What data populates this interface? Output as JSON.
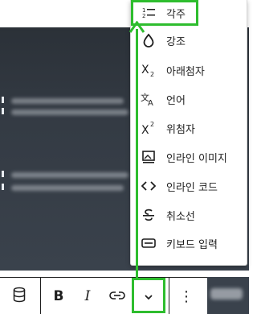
{
  "menu": {
    "items": [
      {
        "label": "각주",
        "icon": "footnote-icon"
      },
      {
        "label": "강조",
        "icon": "drop-icon"
      },
      {
        "label": "아래첨자",
        "icon": "subscript-icon"
      },
      {
        "label": "언어",
        "icon": "language-icon"
      },
      {
        "label": "위첨자",
        "icon": "superscript-icon"
      },
      {
        "label": "인라인 이미지",
        "icon": "inline-image-icon"
      },
      {
        "label": "인라인 코드",
        "icon": "code-icon"
      },
      {
        "label": "취소선",
        "icon": "strikethrough-icon"
      },
      {
        "label": "키보드 입력",
        "icon": "keyboard-icon"
      }
    ]
  },
  "toolbar": {
    "bold_label": "B",
    "italic_label": "I",
    "more_label": "⋮",
    "chevron_label": "⌄"
  },
  "colors": {
    "highlight": "#2ebd2e",
    "background": "#343b44"
  }
}
